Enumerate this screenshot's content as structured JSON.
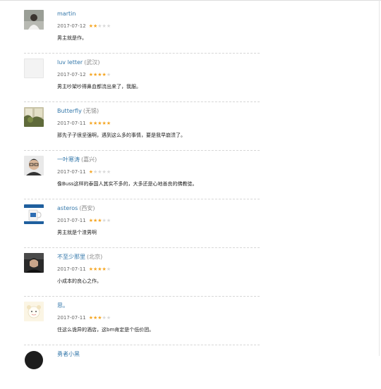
{
  "reviews": [
    {
      "name": "martin",
      "location": "",
      "date": "2017-07-12",
      "rating": 2,
      "comment": "男主就是作。",
      "avatar": "photo-person-white-shirt"
    },
    {
      "name": "luv letter",
      "location": "(武汉)",
      "date": "2017-07-12",
      "rating": 4,
      "comment": "男主吵架吵得鼻血都流出来了，我服。",
      "avatar": "blank"
    },
    {
      "name": "Butterfly",
      "location": "(无锡)",
      "date": "2017-07-11",
      "rating": 5,
      "comment": "那先子子很坚强啊，遇到这么多的事情，要是我早崩溃了。",
      "avatar": "photo-window-plants"
    },
    {
      "name": "一叶寒涛",
      "location": "(嘉兴)",
      "date": "2017-07-11",
      "rating": 1,
      "comment": "像Buss这样的泰国人其实不多的，大多还是心地善良的佛教徒。",
      "avatar": "photo-man-glasses"
    },
    {
      "name": "asteros",
      "location": "(西安)",
      "date": "2017-07-11",
      "rating": 3,
      "comment": "男主就是个渣男啊",
      "avatar": "photo-cup-blue"
    },
    {
      "name": "不至少那里",
      "location": "(北京)",
      "date": "2017-07-11",
      "rating": 4,
      "comment": "小成本的良心之作。",
      "avatar": "photo-dark-portrait"
    },
    {
      "name": "思。",
      "location": "",
      "date": "2017-07-11",
      "rating": 3,
      "comment": "住这么诡异的酒店，这bm肯定是个低价团。",
      "avatar": "cartoon-cream"
    },
    {
      "name": "勇者小黑",
      "location": "",
      "date": "",
      "rating": 0,
      "comment": "",
      "avatar": "dark-circle"
    }
  ],
  "colors": {
    "username": "#3377aa",
    "star_on": "#f5a623",
    "star_off": "#d9d9d9"
  }
}
